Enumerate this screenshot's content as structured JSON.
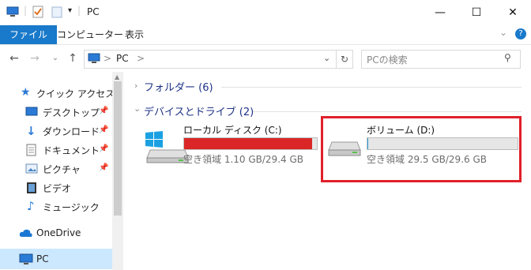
{
  "window": {
    "title": "PC",
    "qat_separator": "|",
    "minimize_glyph": "—",
    "maximize_glyph": "☐",
    "close_glyph": "✕"
  },
  "ribbon": {
    "tabs": [
      {
        "label": "ファイル",
        "active": true
      },
      {
        "label": "コンピューター"
      },
      {
        "label": "表示"
      }
    ],
    "expand_glyph": "⌄",
    "help_glyph": "?"
  },
  "nav": {
    "back_glyph": "←",
    "forward_glyph": "→",
    "recent_glyph": "⌄",
    "up_glyph": "↑"
  },
  "address": {
    "crumbs": [
      "PC"
    ],
    "separator": ">",
    "dropdown_glyph": "⌄",
    "refresh_glyph": "↻"
  },
  "search": {
    "placeholder": "PCの検索",
    "icon_glyph": "⚲"
  },
  "sidebar": {
    "quick_access": "クイック アクセス",
    "items": [
      {
        "label": "デスクトップ",
        "icon": "desktop-icon",
        "pinned": true
      },
      {
        "label": "ダウンロード",
        "icon": "download-icon",
        "pinned": true
      },
      {
        "label": "ドキュメント",
        "icon": "document-icon",
        "pinned": true
      },
      {
        "label": "ピクチャ",
        "icon": "picture-icon",
        "pinned": true
      },
      {
        "label": "ビデオ",
        "icon": "video-icon",
        "pinned": false
      },
      {
        "label": "ミュージック",
        "icon": "music-icon",
        "pinned": false
      }
    ],
    "onedrive": "OneDrive",
    "pc": "PC",
    "pin_glyph": "📌"
  },
  "main": {
    "folders_header": "フォルダー (6)",
    "drives_header": "デバイスとドライブ (2)",
    "drives": [
      {
        "name": "ローカル ディスク (C:)",
        "free_text": "空き領域 1.10 GB/29.4 GB",
        "used_fraction": 0.963,
        "bar_color": "#da2626",
        "icon": "windows-drive-icon"
      },
      {
        "name": "ボリューム (D:)",
        "free_text": "空き領域 29.5 GB/29.6 GB",
        "used_fraction": 0.003,
        "bar_color": "#26a0da",
        "icon": "drive-icon"
      }
    ]
  },
  "colors": {
    "accent": "#1979ca",
    "highlight": "#e0202a"
  }
}
